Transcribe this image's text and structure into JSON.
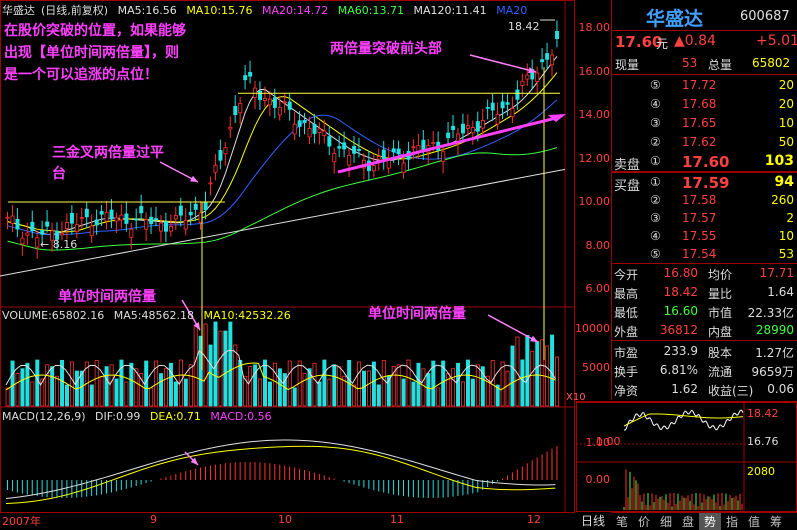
{
  "main_legend": {
    "stock": "华盛达",
    "mode": "(日线,前复权)",
    "ma5": "MA5:16.56",
    "ma10": "MA10:15.76",
    "ma20": "MA20:14.72",
    "ma60": "MA60:13.71",
    "ma120": "MA120:11.41",
    "ma_tail": "MA20"
  },
  "price_axis": [
    "18.00",
    "16.00",
    "14.00",
    "12.00",
    "10.00",
    "8.00",
    "6.00"
  ],
  "marks": {
    "high": "18.42",
    "low": "8.16"
  },
  "annotations": {
    "main_note": "在股价突破的位置，如果能够出现【单位时间两倍量】，则是一个可以追涨的点位！",
    "breakout_head": "两倍量突破前头部",
    "three_gold": "三金叉两倍量过平台",
    "unit_volume_left": "单位时间两倍量",
    "unit_volume_right": "单位时间两倍量"
  },
  "volume_legend": {
    "vol": "VOLUME:65802.16",
    "ma5": "MA5:48562.18",
    "ma10": "MA10:42532.26"
  },
  "volume_axis": [
    "10000",
    "5000"
  ],
  "volume_unit": "X10",
  "macd_legend": {
    "name": "MACD(12,26,9)",
    "dif": "DIF:0.99",
    "dea": "DEA:0.71",
    "macd": "MACD:0.56"
  },
  "macd_axis": [
    "1.00",
    "0.00"
  ],
  "time_axis": [
    "2007年",
    "9",
    "10",
    "11",
    "12"
  ],
  "period_label": "日线",
  "quote": {
    "name": "华盛达",
    "code": "600687",
    "price": "17.60",
    "yuan": "元",
    "change": "▲0.84",
    "change_pct": "+5.01",
    "now_vol_label": "现量",
    "now_vol": "53",
    "total_vol_label": "总量",
    "total_vol": "65802",
    "sell_label": "卖盘",
    "asks": [
      {
        "lv": "⑤",
        "p": "17.72",
        "v": "20"
      },
      {
        "lv": "④",
        "p": "17.68",
        "v": "20"
      },
      {
        "lv": "③",
        "p": "17.65",
        "v": "10"
      },
      {
        "lv": "②",
        "p": "17.62",
        "v": "50"
      },
      {
        "lv": "①",
        "p": "17.60",
        "v": "103"
      }
    ],
    "buy_label": "买盘",
    "bids": [
      {
        "lv": "①",
        "p": "17.59",
        "v": "94"
      },
      {
        "lv": "②",
        "p": "17.58",
        "v": "260"
      },
      {
        "lv": "③",
        "p": "17.57",
        "v": "2"
      },
      {
        "lv": "④",
        "p": "17.55",
        "v": "10"
      },
      {
        "lv": "⑤",
        "p": "17.54",
        "v": "53"
      }
    ],
    "stats": [
      {
        "l1": "今开",
        "v1": "16.80",
        "l2": "均价",
        "v2": "17.71"
      },
      {
        "l1": "最高",
        "v1": "18.42",
        "l2": "量比",
        "v2": "1.64"
      },
      {
        "l1": "最低",
        "v1": "16.60",
        "l2": "市值",
        "v2": "22.33亿"
      },
      {
        "l1": "外盘",
        "v1": "36812",
        "l2": "内盘",
        "v2": "28990"
      }
    ],
    "stats2": [
      {
        "l1": "市盈",
        "v1": "233.9",
        "l2": "股本",
        "v2": "1.27亿"
      },
      {
        "l1": "换手",
        "v1": "6.81%",
        "l2": "流通",
        "v2": "9659万"
      },
      {
        "l1": "净资",
        "v1": "1.62",
        "l2": "收益(三)",
        "v2": "0.06"
      }
    ]
  },
  "mini_chart": {
    "high": "18.42",
    "low": "16.76",
    "vol": "2080"
  },
  "tabs": [
    "笔",
    "价",
    "细",
    "盘",
    "势",
    "指",
    "值",
    "筹"
  ],
  "active_tab": "势"
}
